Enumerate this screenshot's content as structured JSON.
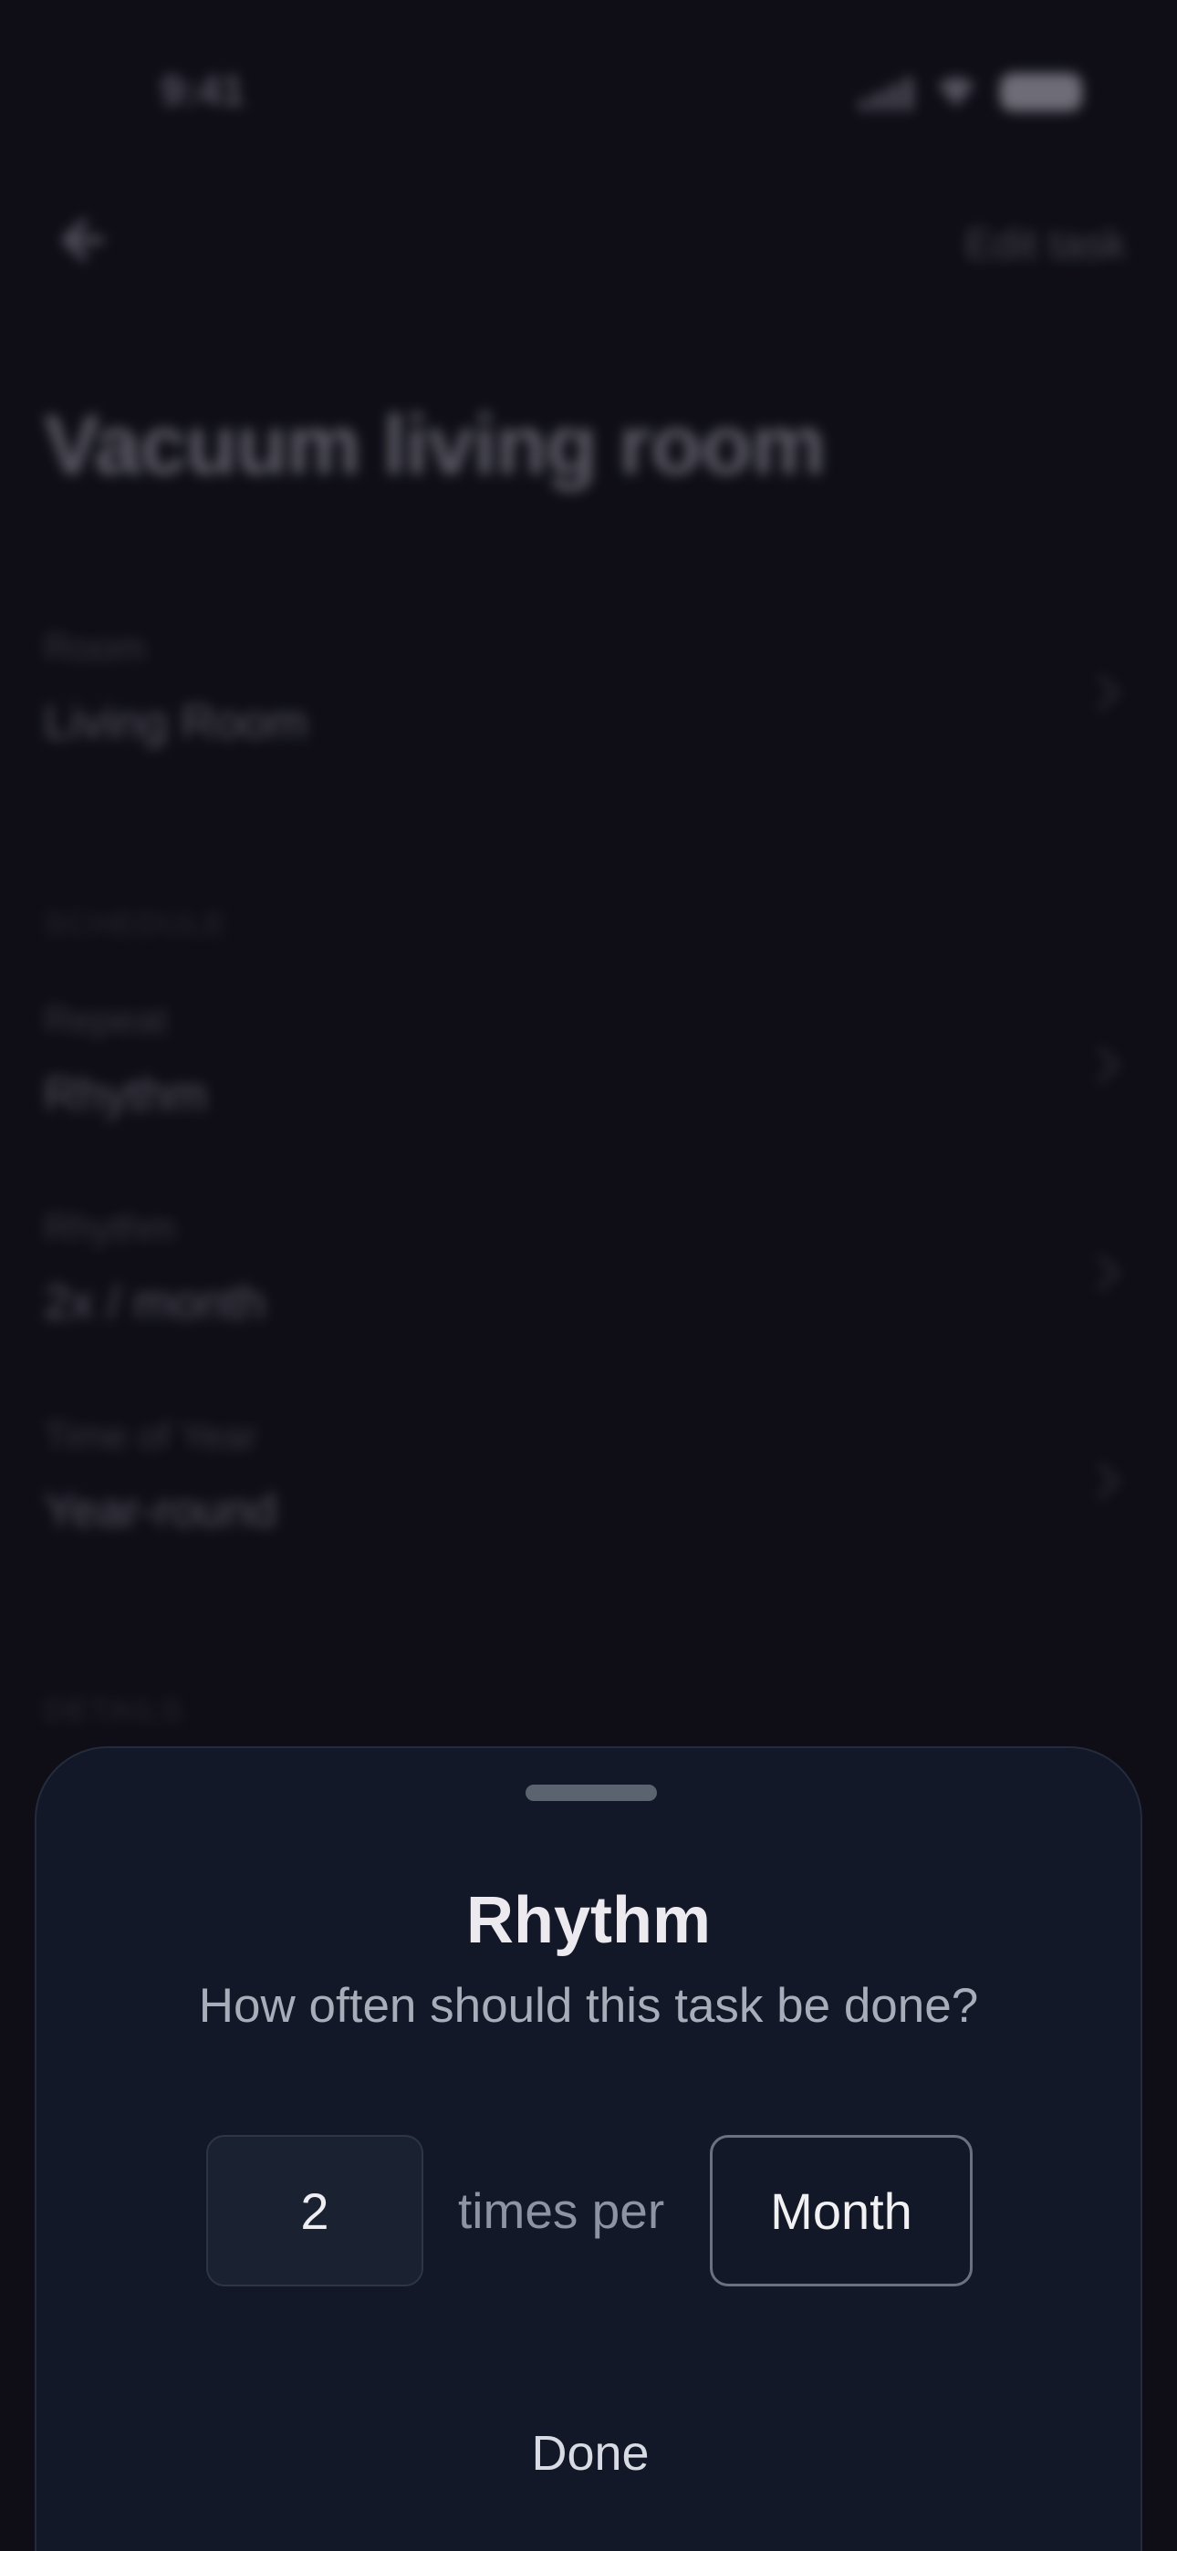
{
  "status_bar": {
    "time": "9:41"
  },
  "nav": {
    "back_icon": "arrow-left-icon",
    "edit_label": "Edit task"
  },
  "task": {
    "title": "Vacuum living room"
  },
  "fields": {
    "room": {
      "label": "Room",
      "value": "Living Room"
    },
    "schedule_section": "SCHEDULE",
    "repeat": {
      "label": "Repeat",
      "value": "Rhythm"
    },
    "rhythm": {
      "label": "Rhythm",
      "value": "2x / month"
    },
    "time_of_year": {
      "label": "Time of Year",
      "value": "Year-round"
    },
    "details_section": "DETAILS"
  },
  "sheet": {
    "title": "Rhythm",
    "subtitle": "How often should this task be done?",
    "count_value": "2",
    "times_per_label": "times per",
    "period_value": "Month",
    "done_label": "Done"
  },
  "colors": {
    "background": "#0f0e17",
    "sheet_background": "#121827",
    "title_text": "#ece9ef",
    "muted_text": "#a7adb9"
  }
}
